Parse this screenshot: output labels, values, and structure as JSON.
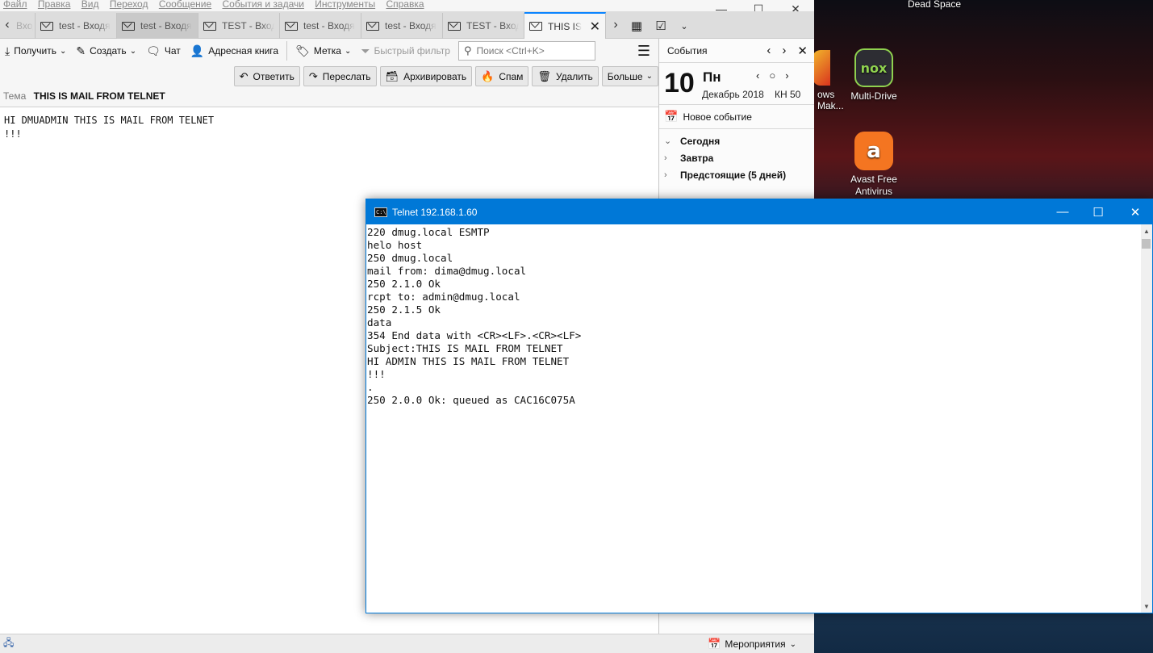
{
  "menubar": [
    "Файл",
    "Правка",
    "Вид",
    "Переход",
    "Сообщение",
    "События и задачи",
    "Инструменты",
    "Справка"
  ],
  "tabs": [
    {
      "label": "Вход"
    },
    {
      "label": "test - Входя"
    },
    {
      "label": "test - Входя"
    },
    {
      "label": "TEST - Входя"
    },
    {
      "label": "test - Входя"
    },
    {
      "label": "test - Входя"
    },
    {
      "label": "TEST - Входя"
    },
    {
      "label": "THIS IS"
    }
  ],
  "toolbar": {
    "get_label": "Получить",
    "write_label": "Создать",
    "chat_label": "Чат",
    "addressbook_label": "Адресная книга",
    "tag_label": "Метка",
    "quickfilter_label": "Быстрый фильтр",
    "search_placeholder": "Поиск <Ctrl+K>"
  },
  "message_actions": {
    "reply": "Ответить",
    "forward": "Переслать",
    "archive": "Архивировать",
    "junk": "Спам",
    "delete": "Удалить",
    "more": "Больше"
  },
  "message": {
    "subject_label": "Тема",
    "subject": "THIS IS MAIL FROM TELNET",
    "body": "HI DMUADMIN THIS IS MAIL FROM TELNET\n!!!"
  },
  "calendar": {
    "header": "События",
    "day_number": "10",
    "day_name": "Пн",
    "month_year": "Декабрь 2018",
    "week": "КН 50",
    "new_event": "Новое событие",
    "groups": [
      "Сегодня",
      "Завтра",
      "Предстоящие (5 дней)"
    ]
  },
  "statusbar": {
    "events_label": "Мероприятия"
  },
  "telnet": {
    "title": "Telnet 192.168.1.60",
    "lines": "220 dmug.local ESMTP\nhelo host\n250 dmug.local\nmail from: dima@dmug.local\n250 2.1.0 Ok\nrcpt to: admin@dmug.local\n250 2.1.5 Ok\ndata\n354 End data with <CR><LF>.<CR><LF>\nSubject:THIS IS MAIL FROM TELNET\nHI ADMIN THIS IS MAIL FROM TELNET\n!!!\n.\n250 2.0.0 Ok: queued as CAC16C075A"
  },
  "desktop": {
    "icons": [
      {
        "label": "Dead Space"
      },
      {
        "label": "ows Mak..."
      },
      {
        "label": "Multi-Drive"
      },
      {
        "label": "Avast Free Antivirus"
      }
    ]
  },
  "colors": {
    "accent": "#0a84ff",
    "console_title": "#0078d7"
  }
}
